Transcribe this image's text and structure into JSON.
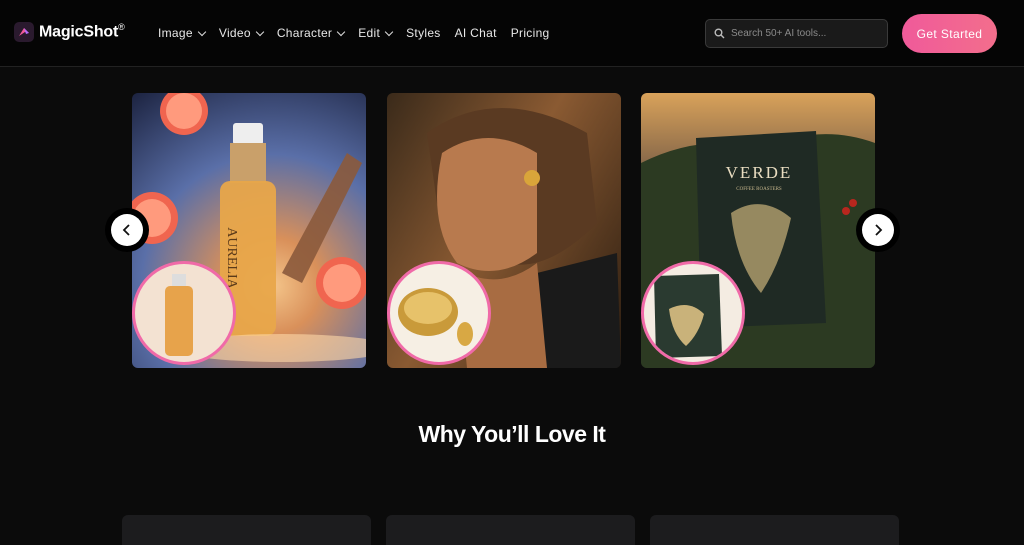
{
  "brand": {
    "name": "MagicShot",
    "mark": "®"
  },
  "nav": {
    "items": [
      {
        "label": "Image",
        "dropdown": true
      },
      {
        "label": "Video",
        "dropdown": true
      },
      {
        "label": "Character",
        "dropdown": true
      },
      {
        "label": "Edit",
        "dropdown": true
      },
      {
        "label": "Styles",
        "dropdown": false
      },
      {
        "label": "AI Chat",
        "dropdown": false
      },
      {
        "label": "Pricing",
        "dropdown": false
      }
    ]
  },
  "search": {
    "placeholder": "Search 50+ AI tools..."
  },
  "cta": {
    "label": "Get Started"
  },
  "carousel": {
    "slides": [
      {
        "product": "AURELIA"
      },
      {
        "product": ""
      },
      {
        "product": "VERDE",
        "subtitle": "COFFEE ROASTERS"
      }
    ]
  },
  "section": {
    "heading": "Why You’ll Love It"
  },
  "colors": {
    "accent": "#f05a9a",
    "background": "#0b0b0b",
    "nav_bg": "#050505"
  }
}
